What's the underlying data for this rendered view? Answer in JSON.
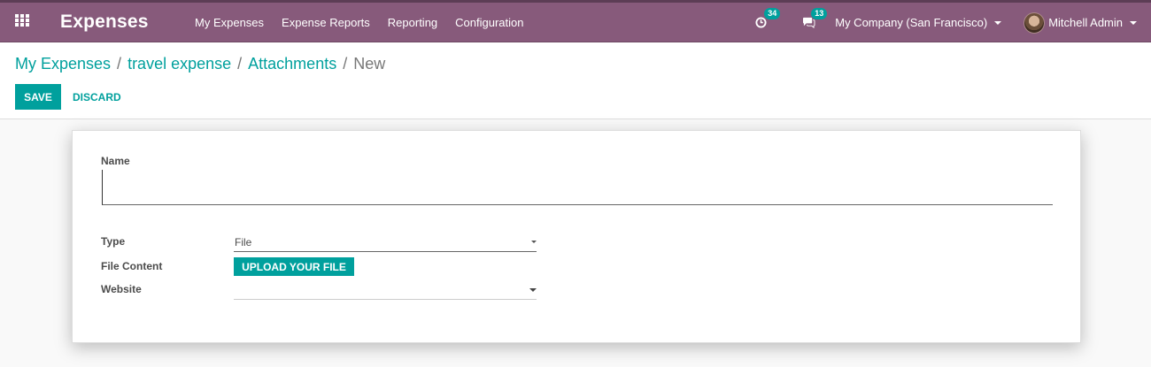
{
  "navbar": {
    "apps_icon": "grid-icon",
    "app_title": "Expenses",
    "menu": [
      "My Expenses",
      "Expense Reports",
      "Reporting",
      "Configuration"
    ],
    "activity_count": "34",
    "messages_count": "13",
    "company": "My Company (San Francisco)",
    "user": "Mitchell Admin",
    "accent_color": "#875a7b"
  },
  "breadcrumb": {
    "items": [
      "My Expenses",
      "travel expense",
      "Attachments"
    ],
    "separator": "/",
    "current": "New"
  },
  "buttons": {
    "save": "SAVE",
    "discard": "DISCARD",
    "primary_color": "#00a09d"
  },
  "form": {
    "name_label": "Name",
    "name_value": "",
    "type_label": "Type",
    "type_value": "File",
    "file_content_label": "File Content",
    "upload_label": "UPLOAD YOUR FILE",
    "website_label": "Website",
    "website_value": ""
  }
}
